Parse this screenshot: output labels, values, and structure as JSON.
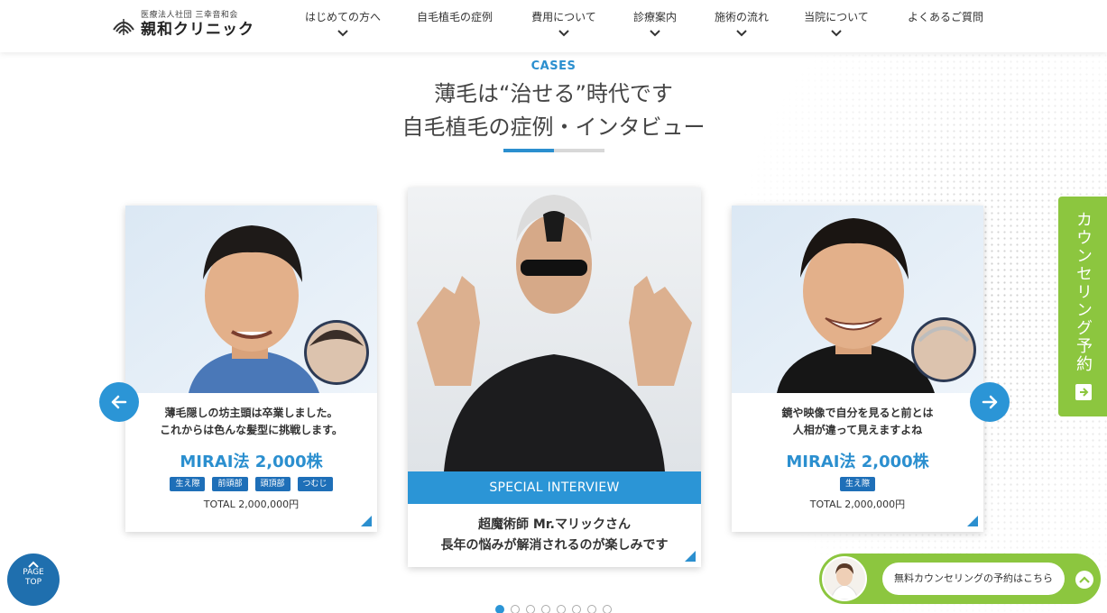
{
  "header": {
    "logo_sub": "医療法人社団 三幸音和会",
    "logo_main": "親和クリニック",
    "nav": [
      {
        "label": "はじめての方へ",
        "dropdown": true
      },
      {
        "label": "自毛植毛の症例",
        "dropdown": false
      },
      {
        "label": "費用について",
        "dropdown": true
      },
      {
        "label": "診療案内",
        "dropdown": true
      },
      {
        "label": "施術の流れ",
        "dropdown": true
      },
      {
        "label": "当院について",
        "dropdown": true
      },
      {
        "label": "よくあるご質問",
        "dropdown": false
      }
    ]
  },
  "section": {
    "label": "CASES",
    "headline_1": "薄毛は“治せる”時代です",
    "headline_2": "自毛植毛の症例・インタビュー"
  },
  "cards": {
    "left": {
      "quote_1": "薄毛隠しの坊主頭は卒業しました。",
      "quote_2": "これからは色んな髪型に挑戦します。",
      "method": "MIRAI法 2,000株",
      "tags": [
        "生え際",
        "前頭部",
        "頭頂部",
        "つむじ"
      ],
      "total": "TOTAL 2,000,000円"
    },
    "center": {
      "band": "SPECIAL INTERVIEW",
      "line_1": "超魔術師 Mr.マリックさん",
      "line_2": "長年の悩みが解消されるのが楽しみです"
    },
    "right": {
      "quote_1": "鏡や映像で自分を見ると前とは",
      "quote_2": "人相が違って見えますよね",
      "method": "MIRAI法 2,000株",
      "tags": [
        "生え際"
      ],
      "total": "TOTAL 2,000,000円"
    }
  },
  "pager": {
    "count": 8,
    "active": 1
  },
  "side_tab": {
    "label": "カウンセリング予約"
  },
  "page_top": {
    "line_1": "PAGE",
    "line_2": "TOP"
  },
  "banner": {
    "text": "無料カウンセリングの予約はこちら"
  },
  "colors": {
    "accent": "#2b95d6",
    "green": "#8cc63f",
    "navy": "#1f6fae",
    "tag": "#1e6fb8"
  }
}
